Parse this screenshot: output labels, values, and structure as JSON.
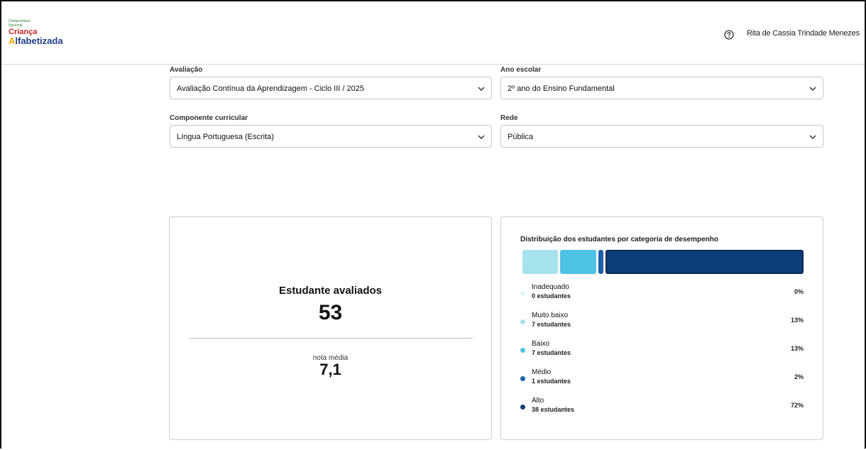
{
  "header": {
    "logo": {
      "line1": "Compromisso",
      "line2": "Nacional",
      "line3": "Criança",
      "line4_first": "A",
      "line4_rest": "lfabetizada"
    },
    "user_name": "Rita de Cassia Trindade Menezes",
    "help_icon": "question-circle-icon"
  },
  "filters": {
    "avaliacao": {
      "label": "Avaliação",
      "value": "Avaliação Contínua da Aprendizagem - Ciclo III / 2025"
    },
    "ano_escolar": {
      "label": "Ano escolar",
      "value": "2º ano do Ensino Fundamental"
    },
    "componente": {
      "label": "Componente curricular",
      "value": "Língua Portuguesa (Escrita)"
    },
    "rede": {
      "label": "Rede",
      "value": "Pública"
    }
  },
  "summary": {
    "title": "Estudante avaliados",
    "count": "53",
    "avg_label": "nota média",
    "avg_value": "7,1"
  },
  "distribution": {
    "title": "Distribuição dos estudantes por categoria de desempenho",
    "categories": [
      {
        "name": "Inadequado",
        "count": "0 estudantes",
        "pct": "0%",
        "value": 0,
        "color": "#e3f6fa"
      },
      {
        "name": "Muito baixo",
        "count": "7 estudantes",
        "pct": "13%",
        "value": 13,
        "color": "#a7e3ec"
      },
      {
        "name": "Baixo",
        "count": "7 estudantes",
        "pct": "13%",
        "value": 13,
        "color": "#4fc3e6"
      },
      {
        "name": "Médio",
        "count": "1 estudantes",
        "pct": "2%",
        "value": 2,
        "color": "#1f5fa8"
      },
      {
        "name": "Alto",
        "count": "38 estudantes",
        "pct": "72%",
        "value": 72,
        "color": "#0d3d7a"
      }
    ]
  }
}
